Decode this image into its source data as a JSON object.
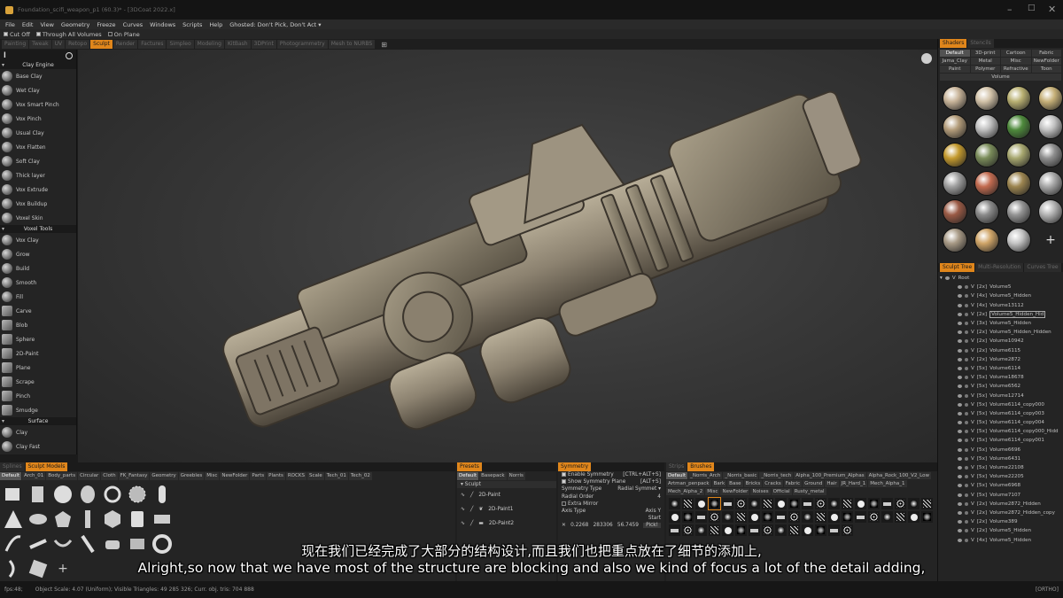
{
  "window": {
    "title": "Foundation_scifi_weapon_p1 (60.3)* - [3DCoat 2022.x]"
  },
  "menu": [
    "File",
    "Edit",
    "View",
    "Geometry",
    "Freeze",
    "Curves",
    "Windows",
    "Scripts",
    "Help",
    "Ghosted: Don't Pick, Don't Act"
  ],
  "options": {
    "cut_off": "Cut Off",
    "through": "Through All Volumes",
    "on_plane": "On Plane"
  },
  "rooms": [
    "Painting",
    "Tweak",
    "UV",
    "Retopo",
    "Sculpt",
    "Render",
    "Factures",
    "Simpleo",
    "Modeling",
    "KitBash",
    "3DPrint",
    "Photogrammetry",
    "Mesh to NURBS"
  ],
  "active_room": "Sculpt",
  "tools": {
    "groups": [
      {
        "name": "Clay Engine",
        "items": [
          "Base Clay",
          "Wet Clay",
          "Vox Smart Pinch",
          "Vox Pinch",
          "Usual Clay",
          "Vox Flatten",
          "Soft Clay",
          "Thick layer",
          "Vox Extrude",
          "Vox Buildup",
          "Voxel Skin"
        ]
      },
      {
        "name": "Voxel Tools",
        "items": [
          "Vox Clay",
          "Grow",
          "Build",
          "Smooth",
          "Fill",
          "Carve",
          "Blob",
          "Sphere",
          "2D-Paint",
          "Plane",
          "Scrape",
          "Pinch",
          "Smudge"
        ]
      },
      {
        "name": "Surface",
        "items": [
          "Clay",
          "Clay Fast"
        ]
      }
    ]
  },
  "shaders": {
    "tabs": [
      "Shaders",
      "Stencils"
    ],
    "categories": [
      "Default",
      "3D-print",
      "Cartoon",
      "Fabric",
      "Jama_Clay",
      "Metal",
      "Misc",
      "NewFolder",
      "Paint",
      "Polymer",
      "Refractive",
      "Toon",
      "Volume"
    ],
    "colors": [
      "#c9b59a",
      "#d2c2a8",
      "#b9b072",
      "#c6b078",
      "#b39c7a",
      "#bfbfbf",
      "#4e8a3c",
      "#c2c2c2",
      "#c49a2e",
      "#7a8c5a",
      "#a7a76f",
      "#8f8f8f",
      "#a0a0a0",
      "#c26b50",
      "#9c8550",
      "#a8a8a8",
      "#9a5a45",
      "#8a8a8a",
      "#939393",
      "#b3b3b3",
      "#a89a86",
      "#d0a568",
      "#c4c4c4"
    ]
  },
  "sculpt_tree": {
    "tabs": [
      "Sculpt Tree",
      "Multi-Resolution",
      "Curves Tree"
    ],
    "root": "Root",
    "rows": [
      {
        "tag": "[2x]",
        "name": "Volume5"
      },
      {
        "tag": "[4x]",
        "name": "Volume5_Hidden"
      },
      {
        "tag": "[4x]",
        "name": "Volume13112"
      },
      {
        "tag": "[2x]",
        "name": "Volume5_Hidden_Hid",
        "sel": true
      },
      {
        "tag": "[3x]",
        "name": "Volume5_Hidden"
      },
      {
        "tag": "[2x]",
        "name": "Volume5_Hidden_Hidden"
      },
      {
        "tag": "[2x]",
        "name": "Volume10942"
      },
      {
        "tag": "[2x]",
        "name": "Volume6115"
      },
      {
        "tag": "[2x]",
        "name": "Volume2872"
      },
      {
        "tag": "[5x]",
        "name": "Volume6114"
      },
      {
        "tag": "[5x]",
        "name": "Volume18678"
      },
      {
        "tag": "[5x]",
        "name": "Volume6562"
      },
      {
        "tag": "[5x]",
        "name": "Volume12714"
      },
      {
        "tag": "[5x]",
        "name": "Volume6114_copy000"
      },
      {
        "tag": "[5x]",
        "name": "Volume6114_copy003"
      },
      {
        "tag": "[5x]",
        "name": "Volume6114_copy004"
      },
      {
        "tag": "[5x]",
        "name": "Volume6114_copy000_Hidd"
      },
      {
        "tag": "[5x]",
        "name": "Volume6114_copy001"
      },
      {
        "tag": "[5x]",
        "name": "Volume6696"
      },
      {
        "tag": "[5x]",
        "name": "Volume6431"
      },
      {
        "tag": "[5x]",
        "name": "Volume22108"
      },
      {
        "tag": "[5x]",
        "name": "Volume22205"
      },
      {
        "tag": "[5x]",
        "name": "Volume6968"
      },
      {
        "tag": "[5x]",
        "name": "Volume7107"
      },
      {
        "tag": "[2x]",
        "name": "Volume2872_Hidden"
      },
      {
        "tag": "[2x]",
        "name": "Volume2872_Hidden_copy"
      },
      {
        "tag": "[2x]",
        "name": "Volume389"
      },
      {
        "tag": "[2x]",
        "name": "Volume5_Hidden"
      },
      {
        "tag": "[4x]",
        "name": "Volume5_Hidden"
      }
    ]
  },
  "models": {
    "tabs": [
      "Splines",
      "Sculpt Models"
    ],
    "categories": [
      "Default",
      "Arch_01",
      "Body_parts",
      "Circular",
      "Cloth",
      "FK_Fantasy",
      "Geometry",
      "Greebles",
      "Misc",
      "NewFolder",
      "Parts",
      "Plants",
      "ROCKS",
      "Scale",
      "Tech_01",
      "Tech_02"
    ]
  },
  "presets": {
    "tabs": [
      "Presets"
    ],
    "categories": [
      "Default",
      "Basepack",
      "Norris"
    ],
    "group": "Sculpt",
    "items": [
      "2D-Paint",
      "2D-Paint1",
      "2D-Paint2"
    ]
  },
  "symmetry": {
    "title": "Symmetry",
    "rows": [
      {
        "label": "Enable Symmetry",
        "value": "[CTRL+ALT+S]",
        "check": true
      },
      {
        "label": "Show Symmetry Plane",
        "value": "[ALT+S]",
        "check": true
      },
      {
        "label": "Symmetry Type",
        "value": "Radial Symmet ▾"
      },
      {
        "label": "Radial Order",
        "value": "4"
      },
      {
        "label": "Extra Mirror",
        "value": "",
        "check": false
      },
      {
        "label": "Axis Type",
        "value": "Axis Y"
      },
      {
        "label": "",
        "value": "Start"
      }
    ],
    "pick": {
      "a": "0.2268",
      "b": "283306",
      "c": "56.7459",
      "btn": "Pick!"
    }
  },
  "brushes": {
    "tabs": [
      "Strips",
      "Brushes"
    ],
    "categories": [
      "Default",
      "_Norris_Arch",
      "_Norris_basic",
      "_Norris_tech",
      "Alpha_100_Premium_Alphas",
      "Alpha_Rock_100_V2_Low",
      "Artman_penpack",
      "Bark",
      "Base",
      "Bricks",
      "Cracks",
      "Fabric",
      "Ground",
      "Hair",
      "JR_Hard_1",
      "Mech_Alpha_1",
      "Mech_Alpha_2",
      "Misc",
      "NewFolder",
      "Noises",
      "Official",
      "Rusty_metal"
    ]
  },
  "status": {
    "fps": "fps:48;",
    "scale": "Object Scale: 4.07 (Uniform); Visible Triangles: 49 285 326; Curr. obj. tris: 704 888",
    "ortho": "[ORTHO]"
  },
  "subtitles": {
    "cn": "现在我们已经完成了大部分的结构设计,而且我们也把重点放在了细节的添加上,",
    "en": "Alright,so now that we have most of the structure are blocking and also we kind of focus a lot of the detail adding,"
  }
}
